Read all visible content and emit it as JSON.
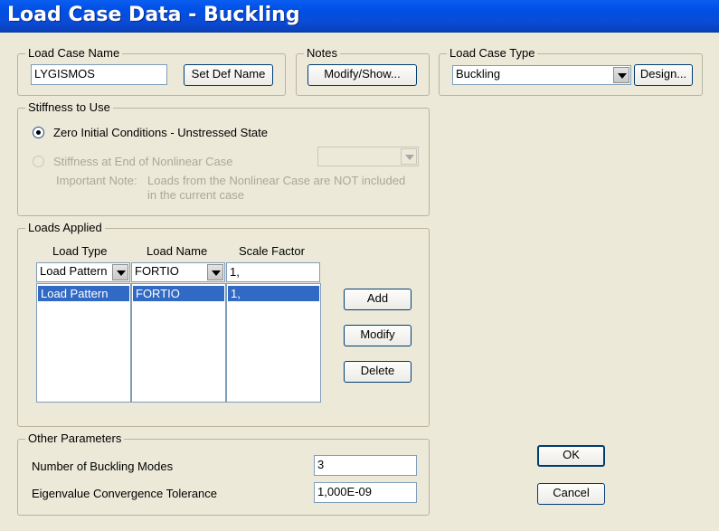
{
  "window": {
    "title": "Load Case Data - Buckling"
  },
  "load_case_name": {
    "group_label": "Load Case Name",
    "value": "LYGISMOS",
    "set_def_name_label": "Set Def Name"
  },
  "notes": {
    "group_label": "Notes",
    "modify_show_label": "Modify/Show..."
  },
  "load_case_type": {
    "group_label": "Load Case Type",
    "selected": "Buckling",
    "design_label": "Design..."
  },
  "stiffness": {
    "group_label": "Stiffness to Use",
    "option_zero": "Zero Initial Conditions - Unstressed State",
    "option_end": "Stiffness at End of Nonlinear Case",
    "note_label": "Important Note:",
    "note_line1": "Loads from the Nonlinear Case are NOT included",
    "note_line2": "in the current case",
    "selected": "zero"
  },
  "loads_applied": {
    "group_label": "Loads Applied",
    "headers": {
      "load_type": "Load Type",
      "load_name": "Load Name",
      "scale_factor": "Scale Factor"
    },
    "edit_row": {
      "load_type": "Load Pattern",
      "load_name": "FORTIO",
      "scale_factor": "1,"
    },
    "rows": [
      {
        "load_type": "Load Pattern",
        "load_name": "FORTIO",
        "scale_factor": "1,"
      }
    ],
    "add_label": "Add",
    "modify_label": "Modify",
    "delete_label": "Delete"
  },
  "other_parameters": {
    "group_label": "Other Parameters",
    "num_modes_label": "Number of Buckling Modes",
    "num_modes_value": "3",
    "tolerance_label": "Eigenvalue Convergence Tolerance",
    "tolerance_value": "1,000E-09"
  },
  "dialog": {
    "ok_label": "OK",
    "cancel_label": "Cancel"
  }
}
